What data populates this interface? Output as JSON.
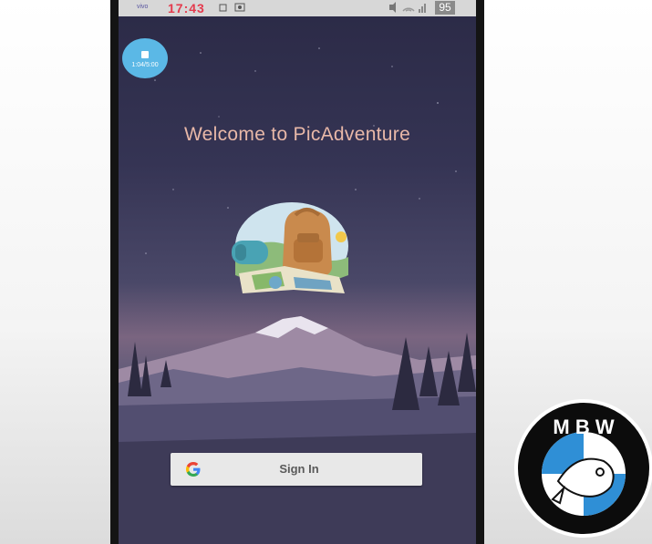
{
  "status_bar": {
    "carrier": "vivo",
    "time": "17:43",
    "battery": "95"
  },
  "screen_recorder": {
    "timer": "1:04/5:00",
    "icon": "stop-icon"
  },
  "welcome": {
    "title": "Welcome to PicAdventure"
  },
  "sign_in": {
    "label": "Sign In",
    "icon": "google-g-icon"
  },
  "watermark": {
    "text": "M B W"
  },
  "colors": {
    "title": "#e8b8a8",
    "button_bg": "#e8e8e8",
    "recorder": "#5bb8e6",
    "time": "#e43a4d"
  }
}
